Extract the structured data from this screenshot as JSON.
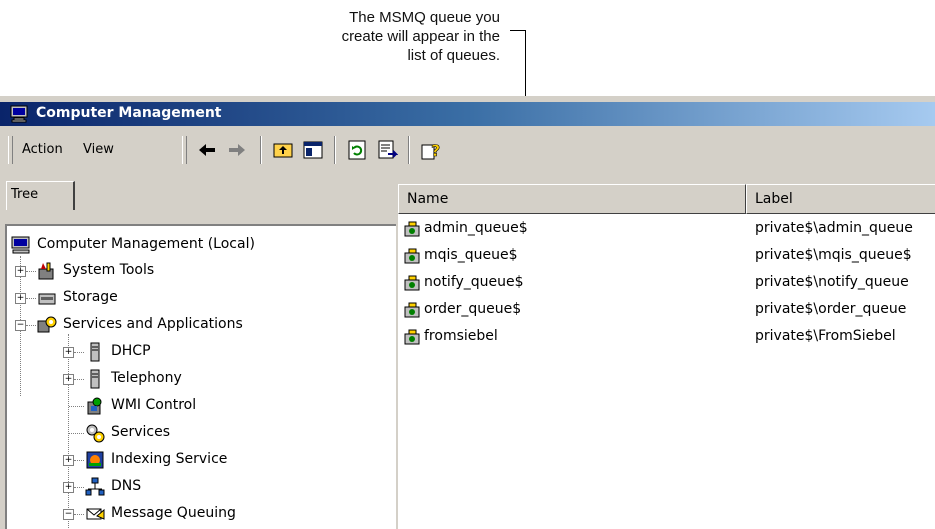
{
  "callout": {
    "line1": "The MSMQ queue you",
    "line2": "create will appear in the",
    "line3": "list of queues."
  },
  "window": {
    "title": "Computer Management",
    "menu": {
      "action": "Action",
      "view": "View"
    }
  },
  "tree_tab": "Tree",
  "tree": {
    "root": "Computer Management (Local)",
    "items": [
      {
        "label": "System Tools",
        "icon": "tools-icon"
      },
      {
        "label": "Storage",
        "icon": "storage-icon"
      },
      {
        "label": "Services and Applications",
        "icon": "services-apps-icon"
      },
      {
        "label": "DHCP",
        "icon": "server-icon"
      },
      {
        "label": "Telephony",
        "icon": "server-icon"
      },
      {
        "label": "WMI Control",
        "icon": "wmi-icon"
      },
      {
        "label": "Services",
        "icon": "gears-icon"
      },
      {
        "label": "Indexing Service",
        "icon": "indexing-icon"
      },
      {
        "label": "DNS",
        "icon": "dns-icon"
      },
      {
        "label": "Message Queuing",
        "icon": "message-queuing-icon"
      }
    ]
  },
  "list": {
    "columns": [
      "Name",
      "Label"
    ],
    "rows": [
      {
        "name": "admin_queue$",
        "label": "private$\\admin_queue"
      },
      {
        "name": "mqis_queue$",
        "label": "private$\\mqis_queue$"
      },
      {
        "name": "notify_queue$",
        "label": "private$\\notify_queue"
      },
      {
        "name": "order_queue$",
        "label": "private$\\order_queue"
      },
      {
        "name": "fromsiebel",
        "label": "private$\\FromSiebel"
      }
    ]
  }
}
